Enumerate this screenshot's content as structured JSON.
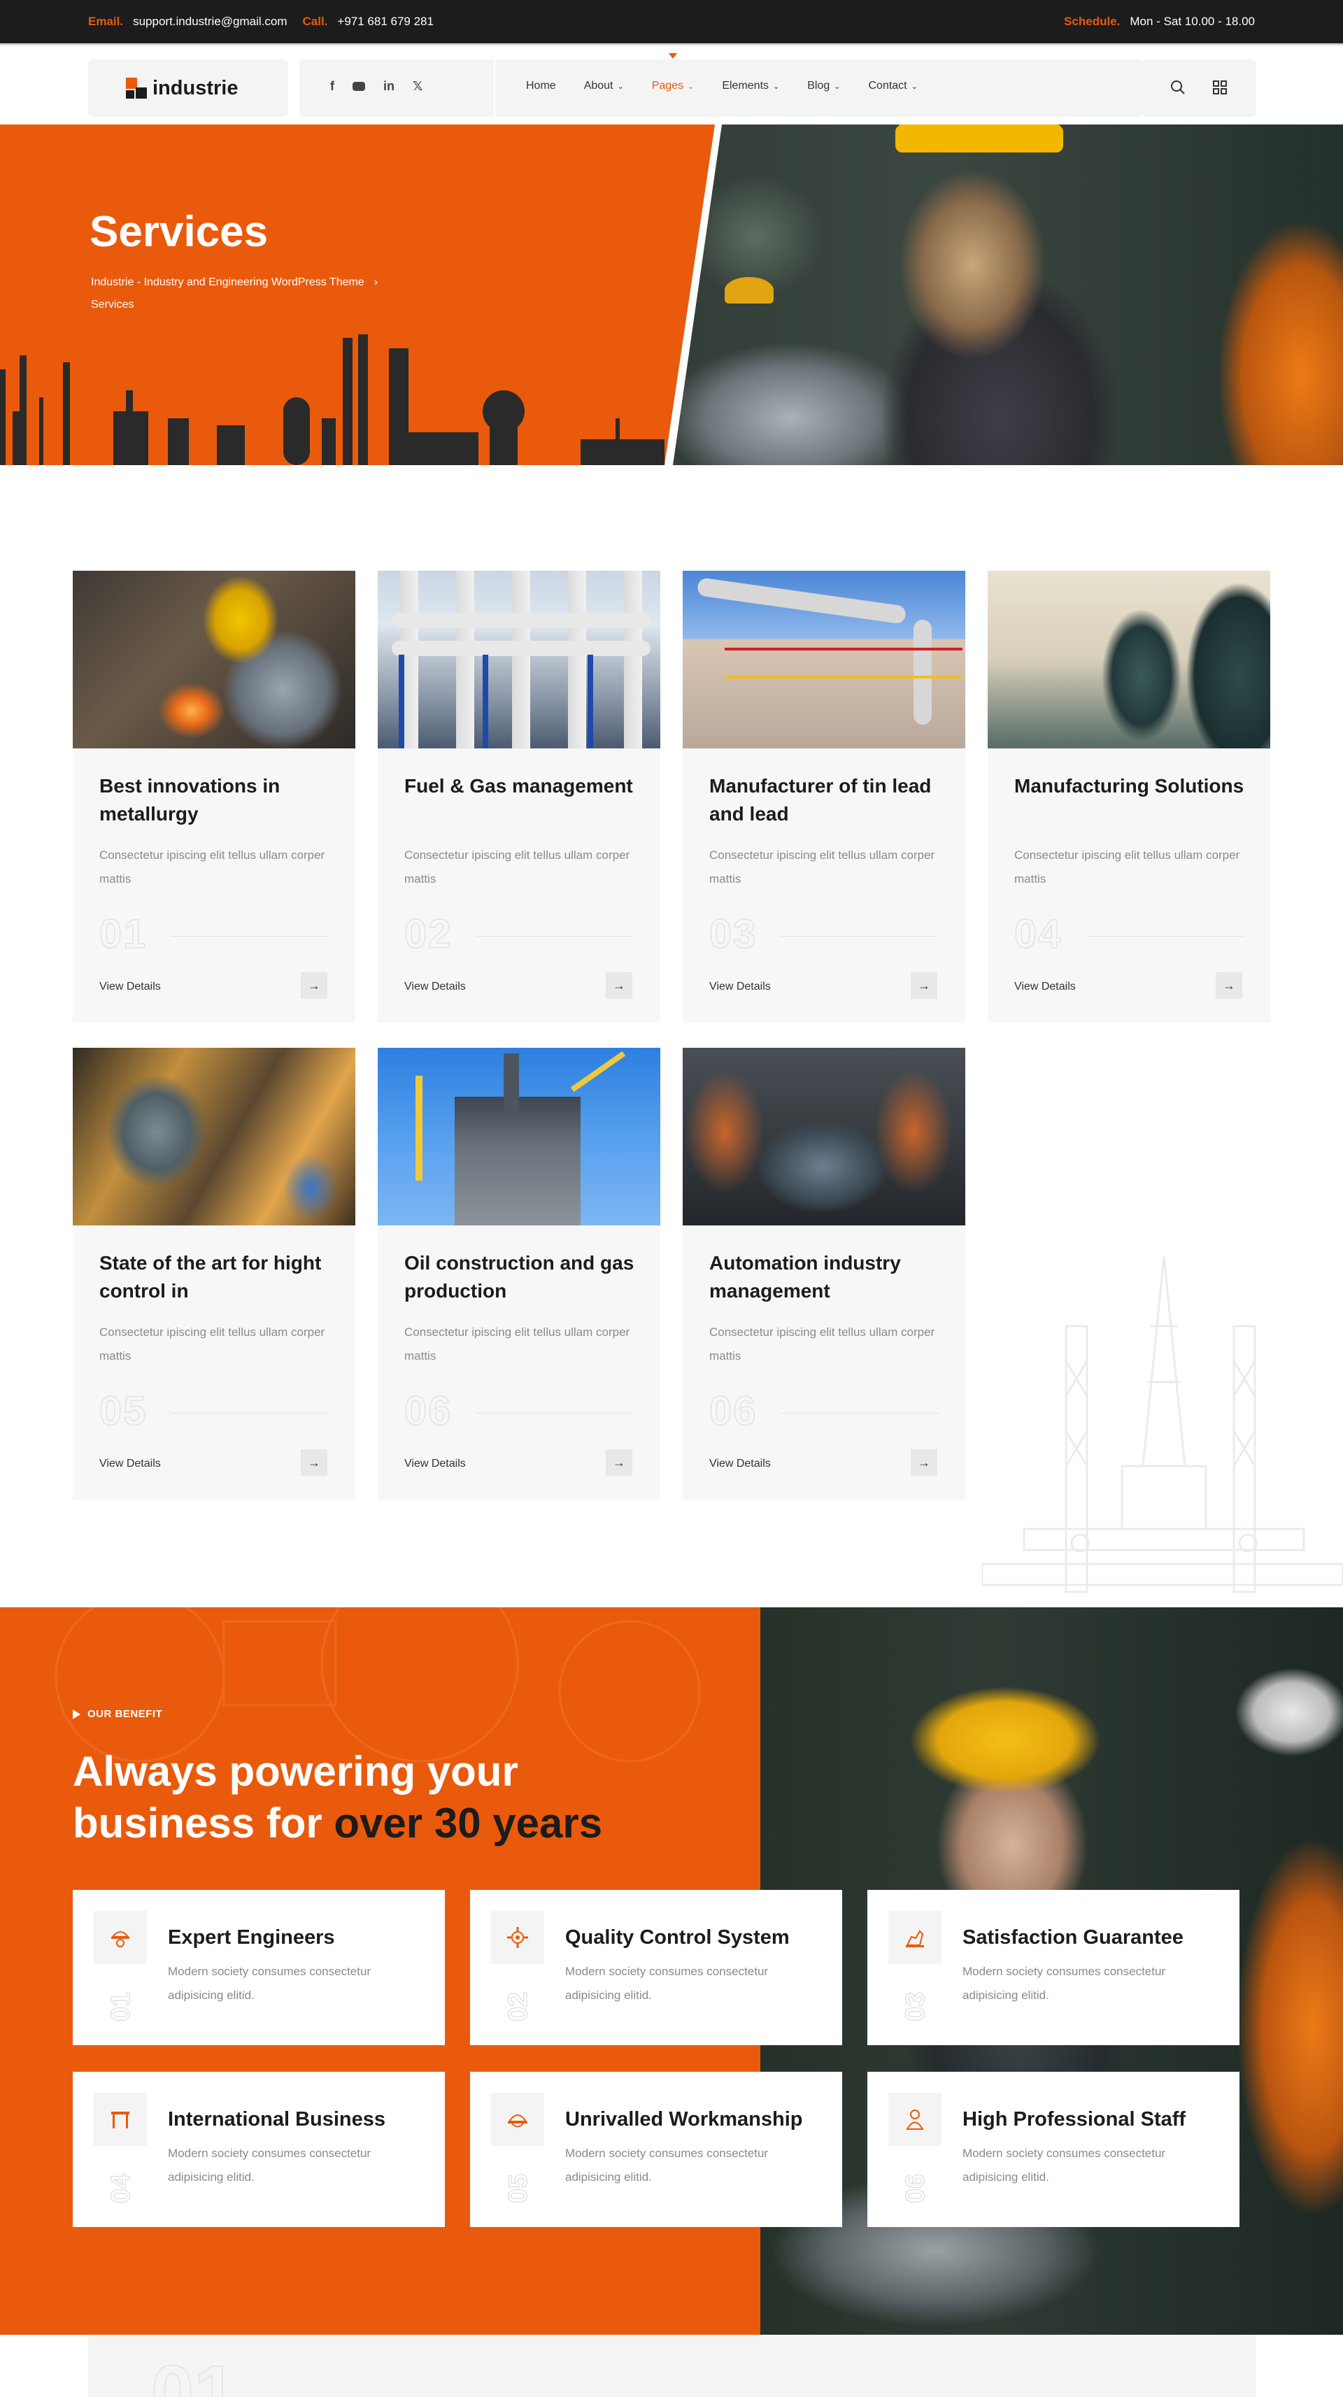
{
  "topbar": {
    "email_label": "Email.",
    "email": "support.industrie@gmail.com",
    "call_label": "Call.",
    "phone": "+971 681 679 281",
    "schedule_label": "Schedule.",
    "schedule": "Mon - Sat 10.00 - 18.00"
  },
  "header": {
    "logo_text": "industrie",
    "menu": [
      {
        "label": "Home"
      },
      {
        "label": "About"
      },
      {
        "label": "Pages"
      },
      {
        "label": "Elements"
      },
      {
        "label": "Blog"
      },
      {
        "label": "Contact"
      }
    ],
    "active_menu": "Pages",
    "social": [
      "f",
      "yt",
      "in",
      "X"
    ]
  },
  "hero": {
    "title": "Services",
    "breadcrumb_home": "Industrie - Industry and Engineering WordPress Theme",
    "breadcrumb_current": "Services"
  },
  "services": [
    {
      "title": "Best innovations in metallurgy",
      "desc": "Consectetur ipiscing elit tellus ullam corper mattis",
      "num": "01",
      "link": "View Details"
    },
    {
      "title": "Fuel & Gas management",
      "desc": "Consectetur ipiscing elit tellus ullam corper mattis",
      "num": "02",
      "link": "View Details"
    },
    {
      "title": "Manufacturer of tin lead and lead",
      "desc": "Consectetur ipiscing elit tellus ullam corper mattis",
      "num": "03",
      "link": "View Details"
    },
    {
      "title": "Manufacturing Solutions",
      "desc": "Consectetur ipiscing elit tellus ullam corper mattis",
      "num": "04",
      "link": "View Details"
    },
    {
      "title": "State of the art for hight control in",
      "desc": "Consectetur ipiscing elit tellus ullam corper mattis",
      "num": "05",
      "link": "View Details"
    },
    {
      "title": "Oil construction and gas production",
      "desc": "Consectetur ipiscing elit tellus ullam corper mattis",
      "num": "06",
      "link": "View Details"
    },
    {
      "title": "Automation industry management",
      "desc": "Consectetur ipiscing elit tellus ullam corper mattis",
      "num": "06",
      "link": "View Details"
    }
  ],
  "benefit": {
    "eyebrow": "OUR BENEFIT",
    "title_line1": "Always powering your",
    "title_line2_a": "business for ",
    "title_line2_b": "over 30 years",
    "features": [
      {
        "title": "Expert Engineers",
        "desc": "Modern society consumes consectetur adipisicing elitid.",
        "num": "01",
        "icon": "engineer-icon"
      },
      {
        "title": "Quality Control System",
        "desc": "Modern society consumes consectetur adipisicing elitid.",
        "num": "02",
        "icon": "gear-icon"
      },
      {
        "title": "Satisfaction Guarantee",
        "desc": "Modern society consumes consectetur adipisicing elitid.",
        "num": "03",
        "icon": "hand-icon"
      },
      {
        "title": "International Business",
        "desc": "Modern society consumes consectetur adipisicing elitid.",
        "num": "04",
        "icon": "gate-icon"
      },
      {
        "title": "Unrivalled Workmanship",
        "desc": "Modern society consumes consectetur adipisicing elitid.",
        "num": "05",
        "icon": "helmet-icon"
      },
      {
        "title": "High Professional Staff",
        "desc": "Modern society consumes consectetur adipisicing elitid.",
        "num": "06",
        "icon": "worker-icon"
      }
    ]
  },
  "footer_teaser": {
    "num": "01"
  },
  "colors": {
    "accent": "#ea5a0c",
    "dark": "#1c1c1c"
  }
}
